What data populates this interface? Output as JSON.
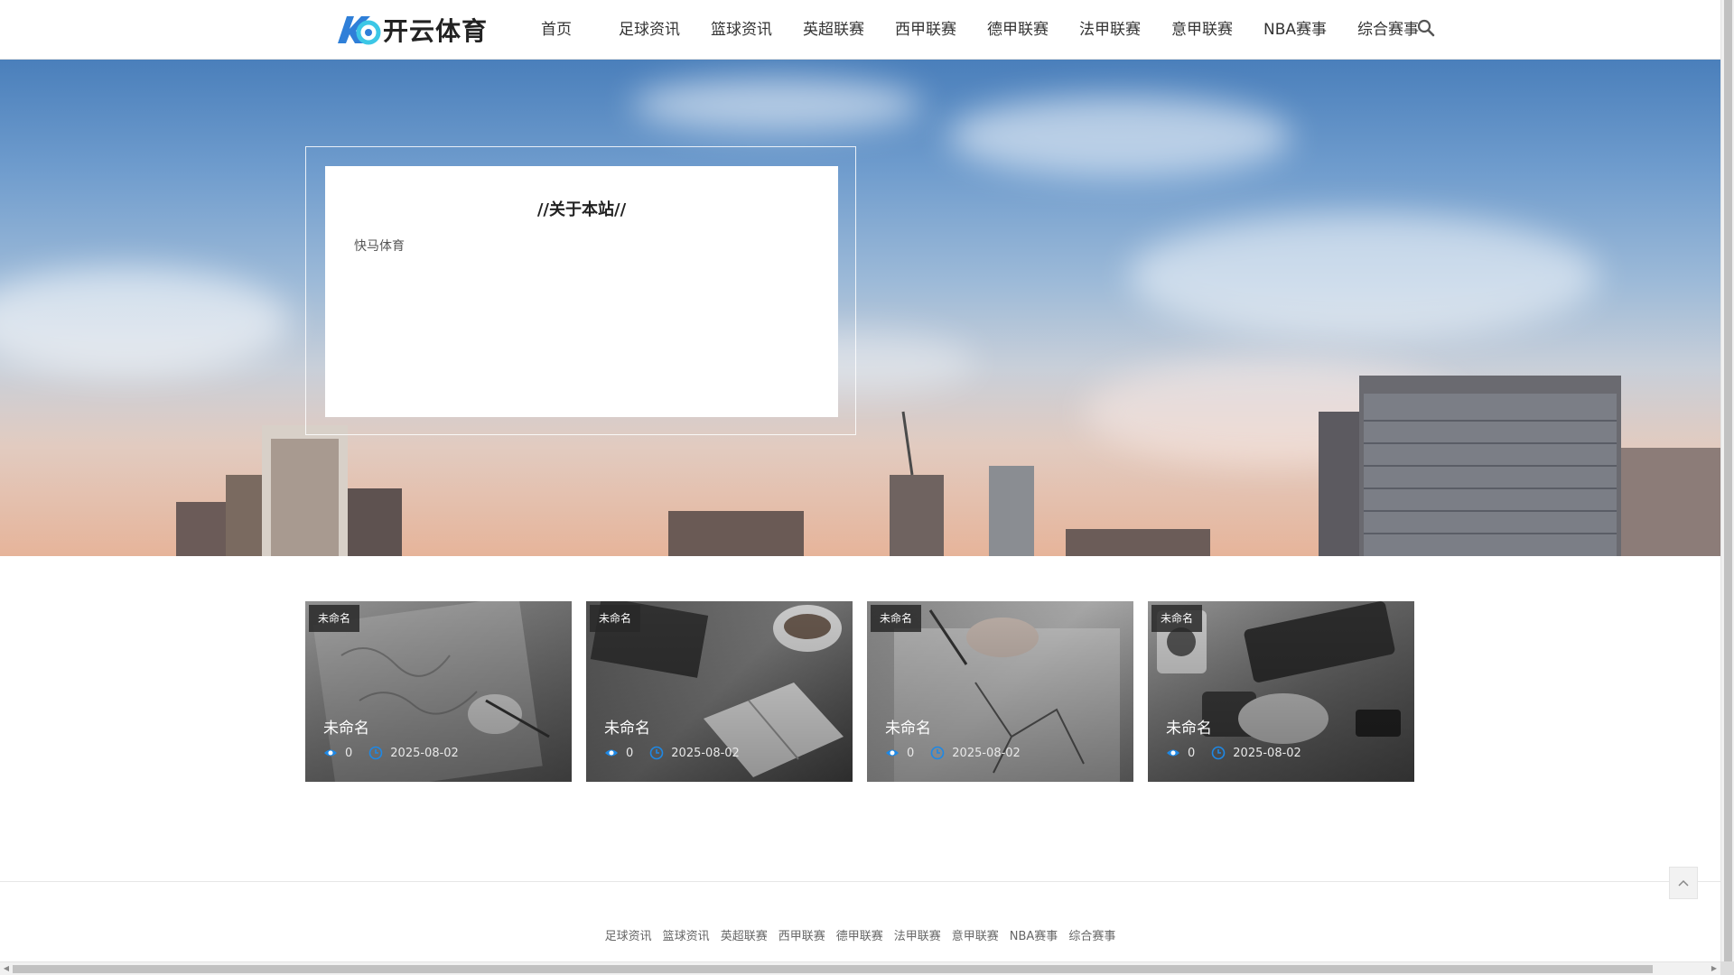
{
  "header": {
    "logo_text": "开云体育",
    "nav": [
      "首页",
      "足球资讯",
      "篮球资讯",
      "英超联赛",
      "西甲联赛",
      "德甲联赛",
      "法甲联赛",
      "意甲联赛",
      "NBA赛事",
      "综合赛事"
    ],
    "search_icon": "search-icon"
  },
  "about": {
    "title": "//关于本站//",
    "text": "快马体育"
  },
  "cards": [
    {
      "tag": "未命名",
      "title": "未命名",
      "views": "0",
      "date": "2025-08-02"
    },
    {
      "tag": "未命名",
      "title": "未命名",
      "views": "0",
      "date": "2025-08-02"
    },
    {
      "tag": "未命名",
      "title": "未命名",
      "views": "0",
      "date": "2025-08-02"
    },
    {
      "tag": "未命名",
      "title": "未命名",
      "views": "0",
      "date": "2025-08-02"
    }
  ],
  "footer": {
    "links": [
      "足球资讯",
      "篮球资讯",
      "英超联赛",
      "西甲联赛",
      "德甲联赛",
      "法甲联赛",
      "意甲联赛",
      "NBA赛事",
      "综合赛事"
    ]
  },
  "colors": {
    "accent": "#1e88e5",
    "logo_blue": "#2f7fd8",
    "logo_cyan": "#3cc7e6"
  }
}
